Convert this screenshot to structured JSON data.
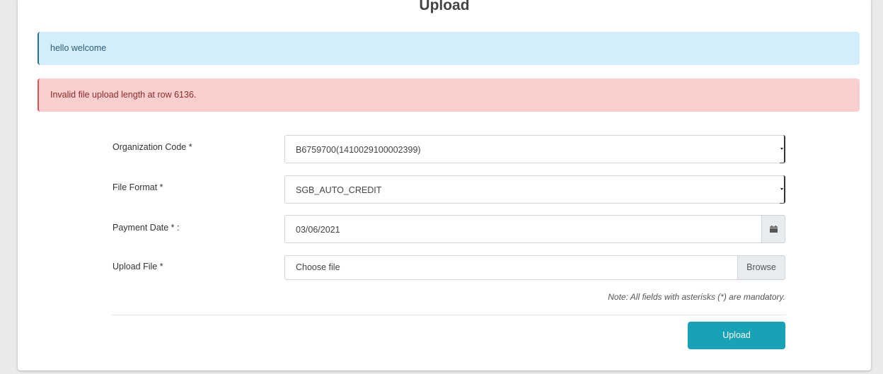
{
  "page": {
    "title": "Upload"
  },
  "alerts": {
    "info": "hello welcome",
    "error": "Invalid file upload length at row 6136."
  },
  "form": {
    "organization_code": {
      "label": "Organization Code *",
      "value": "B6759700(1410029100002399)"
    },
    "file_format": {
      "label": "File Format *",
      "value": "SGB_AUTO_CREDIT"
    },
    "payment_date": {
      "label": "Payment Date * :",
      "value": "03/06/2021",
      "icon": "calendar-icon"
    },
    "upload_file": {
      "label": "Upload File *",
      "placeholder": "Choose file",
      "browse_label": "Browse"
    },
    "note": "Note: All fields with asterisks (*) are mandatory.",
    "submit_label": "Upload"
  },
  "colors": {
    "info_bg": "#d3edfa",
    "error_bg": "#fccfcf",
    "button": "#17a2b8"
  }
}
